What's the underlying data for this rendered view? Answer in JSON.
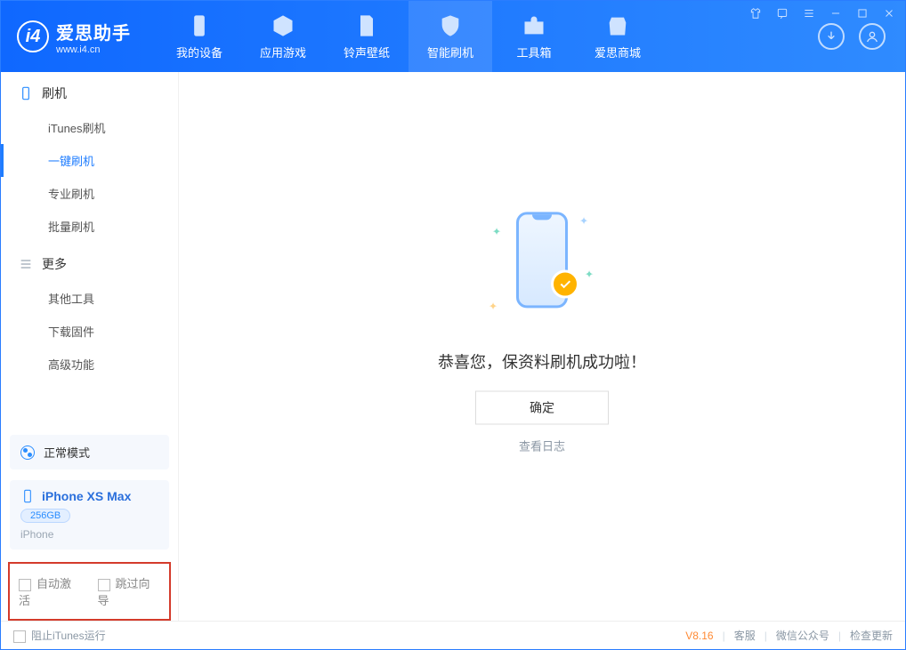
{
  "app": {
    "title": "爱思助手",
    "subtitle": "www.i4.cn"
  },
  "nav": {
    "items": [
      {
        "label": "我的设备"
      },
      {
        "label": "应用游戏"
      },
      {
        "label": "铃声壁纸"
      },
      {
        "label": "智能刷机"
      },
      {
        "label": "工具箱"
      },
      {
        "label": "爱思商城"
      }
    ],
    "active_index": 3
  },
  "sidebar": {
    "group1_title": "刷机",
    "group1": [
      {
        "label": "iTunes刷机"
      },
      {
        "label": "一键刷机"
      },
      {
        "label": "专业刷机"
      },
      {
        "label": "批量刷机"
      }
    ],
    "group1_active_index": 1,
    "group2_title": "更多",
    "group2": [
      {
        "label": "其他工具"
      },
      {
        "label": "下载固件"
      },
      {
        "label": "高级功能"
      }
    ],
    "status_label": "正常模式",
    "device": {
      "name": "iPhone XS Max",
      "storage": "256GB",
      "type": "iPhone"
    },
    "opts": {
      "auto_activate": "自动激活",
      "skip_guide": "跳过向导"
    }
  },
  "main": {
    "success": "恭喜您，保资料刷机成功啦！",
    "ok": "确定",
    "view_log": "查看日志"
  },
  "footer": {
    "block_itunes": "阻止iTunes运行",
    "version": "V8.16",
    "links": {
      "service": "客服",
      "wechat": "微信公众号",
      "update": "检查更新"
    }
  }
}
